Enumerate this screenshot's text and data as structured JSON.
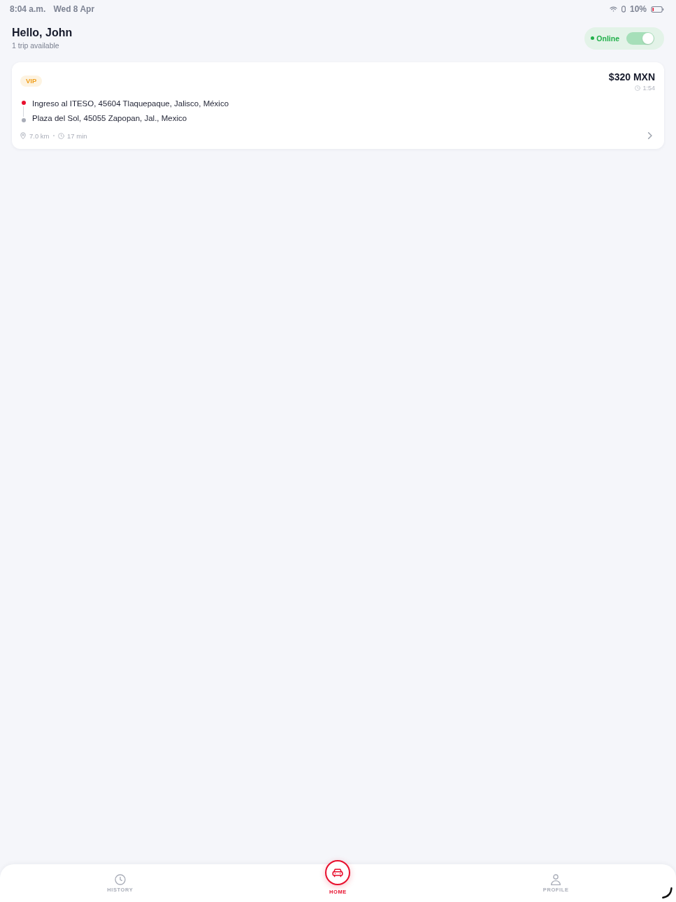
{
  "status_bar": {
    "time": "8:04 a.m.",
    "date": "Wed 8 Apr",
    "battery": "10%"
  },
  "header": {
    "greeting": "Hello, John",
    "subtitle": "1 trip available",
    "status": {
      "label": "Online",
      "on": true
    }
  },
  "trips": [
    {
      "badge": "VIP",
      "price": "$320 MXN",
      "countdown": "1:54",
      "stops": [
        {
          "address": "Ingreso al ITESO, 45604 Tlaquepaque, Jalisco, México",
          "color": "#e8102e"
        },
        {
          "address": "Plaza del Sol, 45055 Zapopan, Jal., Mexico",
          "color": "#a9adb8"
        }
      ],
      "distance": "7.0 km",
      "duration": "17 min"
    }
  ],
  "nav": [
    {
      "label": "HISTORY",
      "kind": "clock",
      "selected": false
    },
    {
      "label": "HOME",
      "kind": "car",
      "selected": true
    },
    {
      "label": "PROFILE",
      "kind": "person",
      "selected": false
    }
  ]
}
